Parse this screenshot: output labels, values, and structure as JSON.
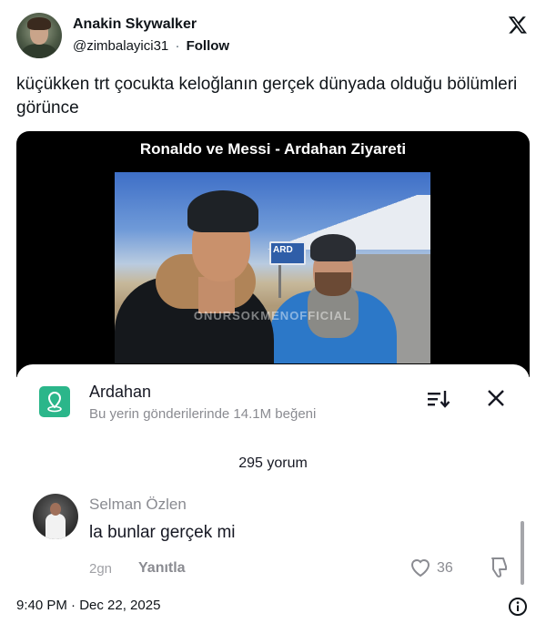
{
  "header": {
    "display_name": "Anakin Skywalker",
    "handle": "@zimbalayici31",
    "separator": "·",
    "follow_label": "Follow",
    "logo_icon": "x-logo-icon"
  },
  "tweet": {
    "text": "küçükken trt çocukta keloğlanın gerçek dünyada olduğu bölümleri görünce"
  },
  "media": {
    "video_title": "Ronaldo ve Messi - Ardahan Ziyareti",
    "sign_text": "ARD",
    "watermark": "ONURSOKMENOFFICIAL",
    "sheet": {
      "location_name": "Ardahan",
      "location_subtitle": "Bu yerin gönderilerinde 14.1M beğeni",
      "location_icon": "map-pin-icon",
      "sort_icon": "sort-icon",
      "close_icon": "close-icon",
      "accent_color": "#2bb68a",
      "comments_count": "295 yorum",
      "comment": {
        "author": "Selman Özlen",
        "text": "la bunlar gerçek mi",
        "time": "2gn",
        "reply_label": "Yanıtla",
        "like_count": "36"
      }
    }
  },
  "footer": {
    "timestamp": "9:40 PM · Dec 22, 2025",
    "info_icon": "info-icon"
  }
}
